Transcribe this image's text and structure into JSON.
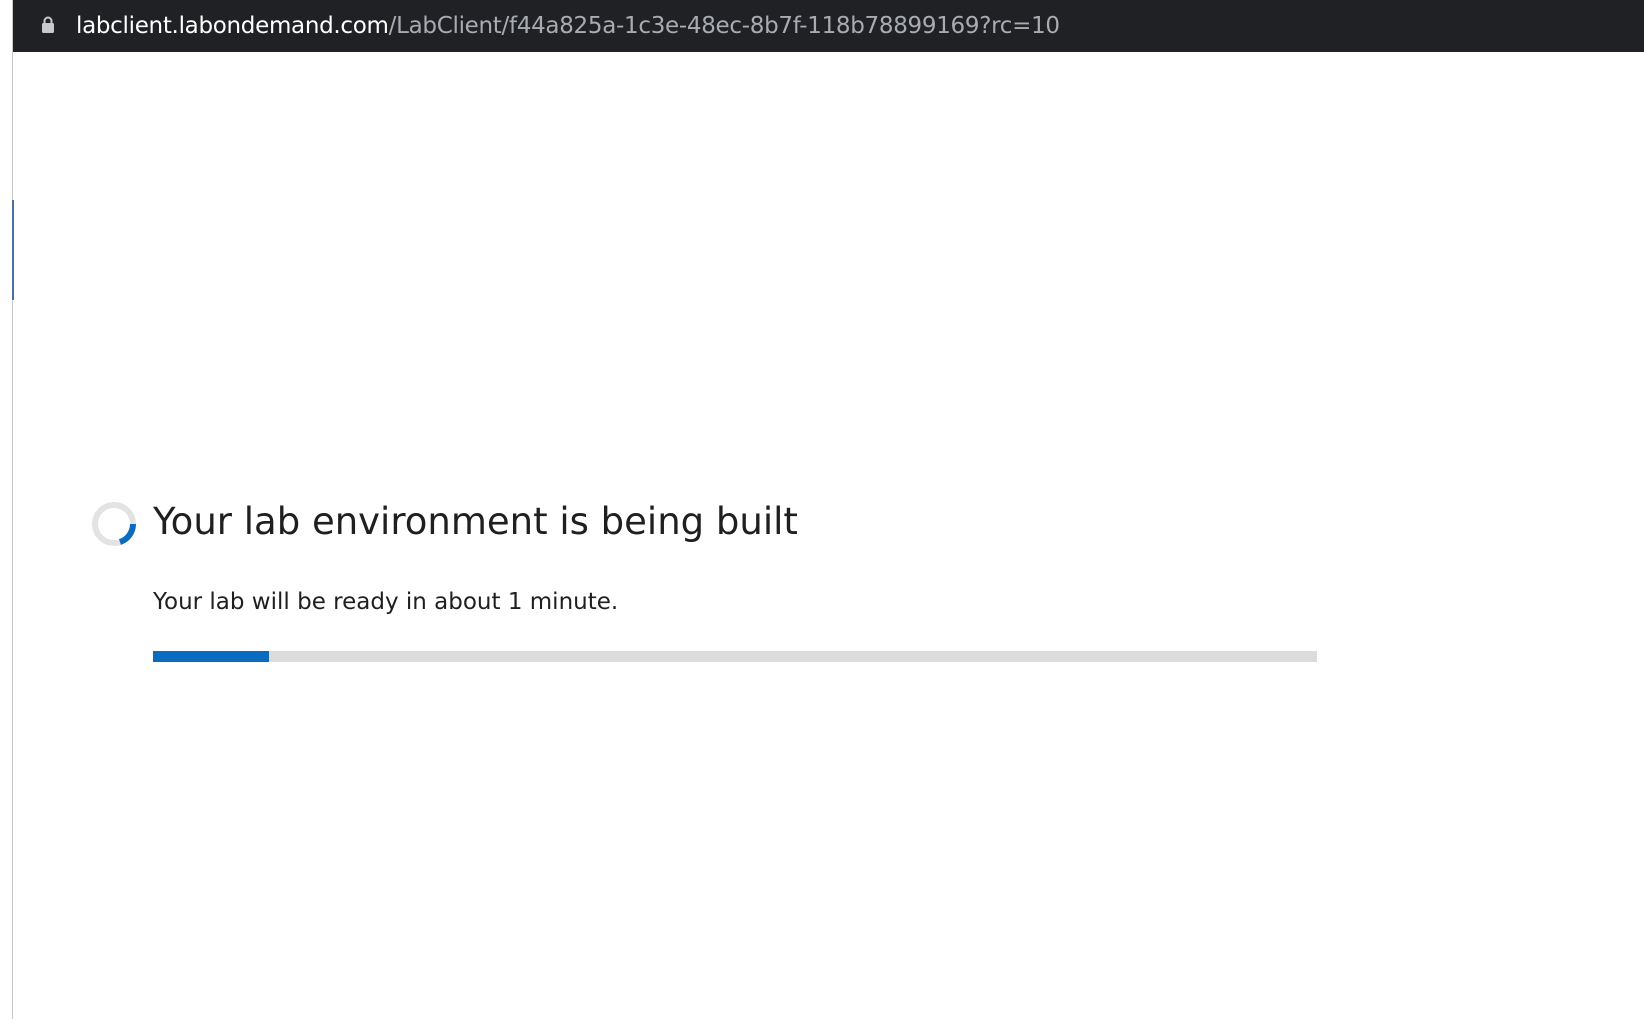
{
  "browser": {
    "url_host": "labclient.labondemand.com",
    "url_path": "/LabClient/f44a825a-1c3e-48ec-8b7f-118b78899169?rc=10",
    "icon": "lock-icon"
  },
  "status": {
    "icon": "spinner-icon",
    "title": "Your lab environment is being built",
    "subtitle": "Your lab will be ready in about 1 minute.",
    "progress_fraction": 0.1,
    "progress_color": "#0b6cbf",
    "track_color": "#dcdcdc"
  }
}
